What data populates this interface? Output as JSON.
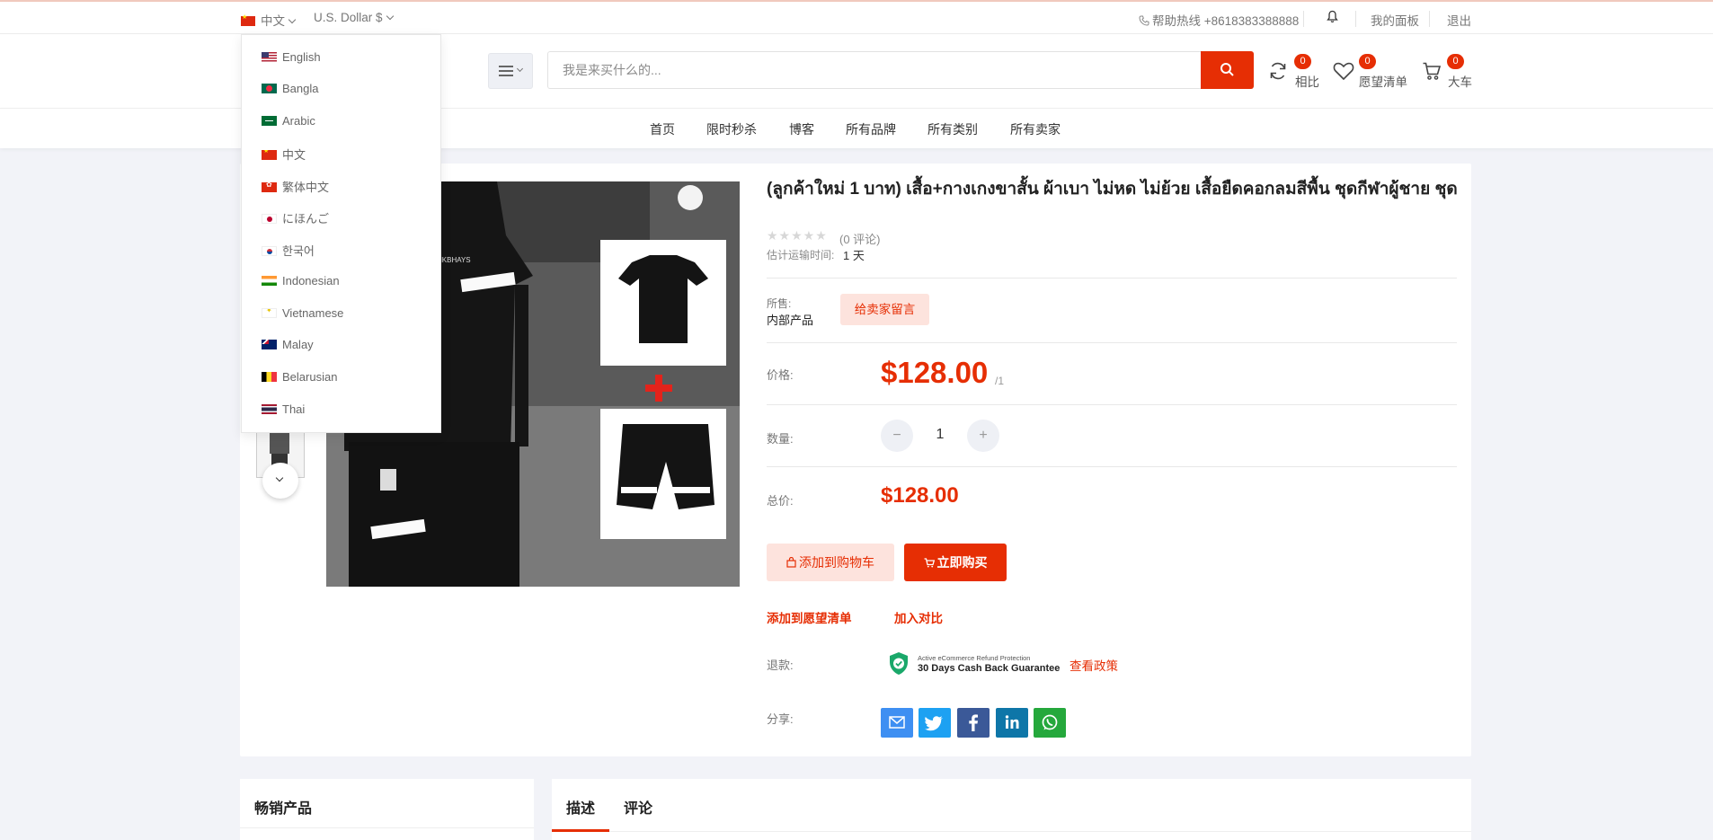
{
  "topbar": {
    "language": "中文",
    "currency": "U.S. Dollar $",
    "hotline": "帮助热线 +8618383388888",
    "dashboard": "我的面板",
    "logout": "退出"
  },
  "header": {
    "search_placeholder": "我是来买什么的...",
    "compare": {
      "label": "相比",
      "count": "0"
    },
    "wishlist": {
      "label": "愿望清单",
      "count": "0"
    },
    "cart": {
      "label": "大车",
      "count": "0"
    }
  },
  "nav": [
    "首页",
    "限时秒杀",
    "博客",
    "所有品牌",
    "所有类别",
    "所有卖家"
  ],
  "languages": [
    "English",
    "Bangla",
    "Arabic",
    "中文",
    "繁体中文",
    "にほんご",
    "한국어",
    "Indonesian",
    "Vietnamese",
    "Malay",
    "Belarusian",
    "Thai"
  ],
  "product": {
    "title": "(ลูกค้าใหม่ 1 บาท) เสื้อ+กางเกงขาสั้น ผ้าเบา ไม่หด ไม่ย้วย เสื้อยืดคอกลมสีพื้น ชุดกีฬาผู้ชาย ชุด",
    "stars": "★★★★★",
    "reviews": "(0 评论)",
    "shipping_label": "估计运输时间:",
    "shipping_value": "1 天",
    "sold_by_label": "所售:",
    "sold_by_value": "内部产品",
    "message_seller": "给卖家留言",
    "price_label": "价格:",
    "price": "$128.00",
    "unit": "/1",
    "qty_label": "数量:",
    "qty_minus": "−",
    "qty": "1",
    "qty_plus": "+",
    "total_label": "总价:",
    "total": "$128.00",
    "add_to_cart": "添加到购物车",
    "buy_now": "立即购买",
    "add_wishlist": "添加到愿望清单",
    "add_compare": "加入对比",
    "refund_label": "退款:",
    "refund_small": "Active eCommerce Refund Protection",
    "refund_big": "30 Days Cash Back Guarantee",
    "view_policy": "查看政策",
    "share_label": "分享:",
    "image_text": "DINKBHAYS"
  },
  "bottom": {
    "best_selling": "畅销产品",
    "tab_description": "描述",
    "tab_reviews": "评论"
  },
  "colors": {
    "accent": "#e62e04",
    "accent_light": "#fde3dd",
    "share_email": "#3e8ff2",
    "share_twitter": "#1da1f2",
    "share_facebook": "#3b5998",
    "share_linkedin": "#0e76a8",
    "share_whatsapp": "#25a83c"
  }
}
